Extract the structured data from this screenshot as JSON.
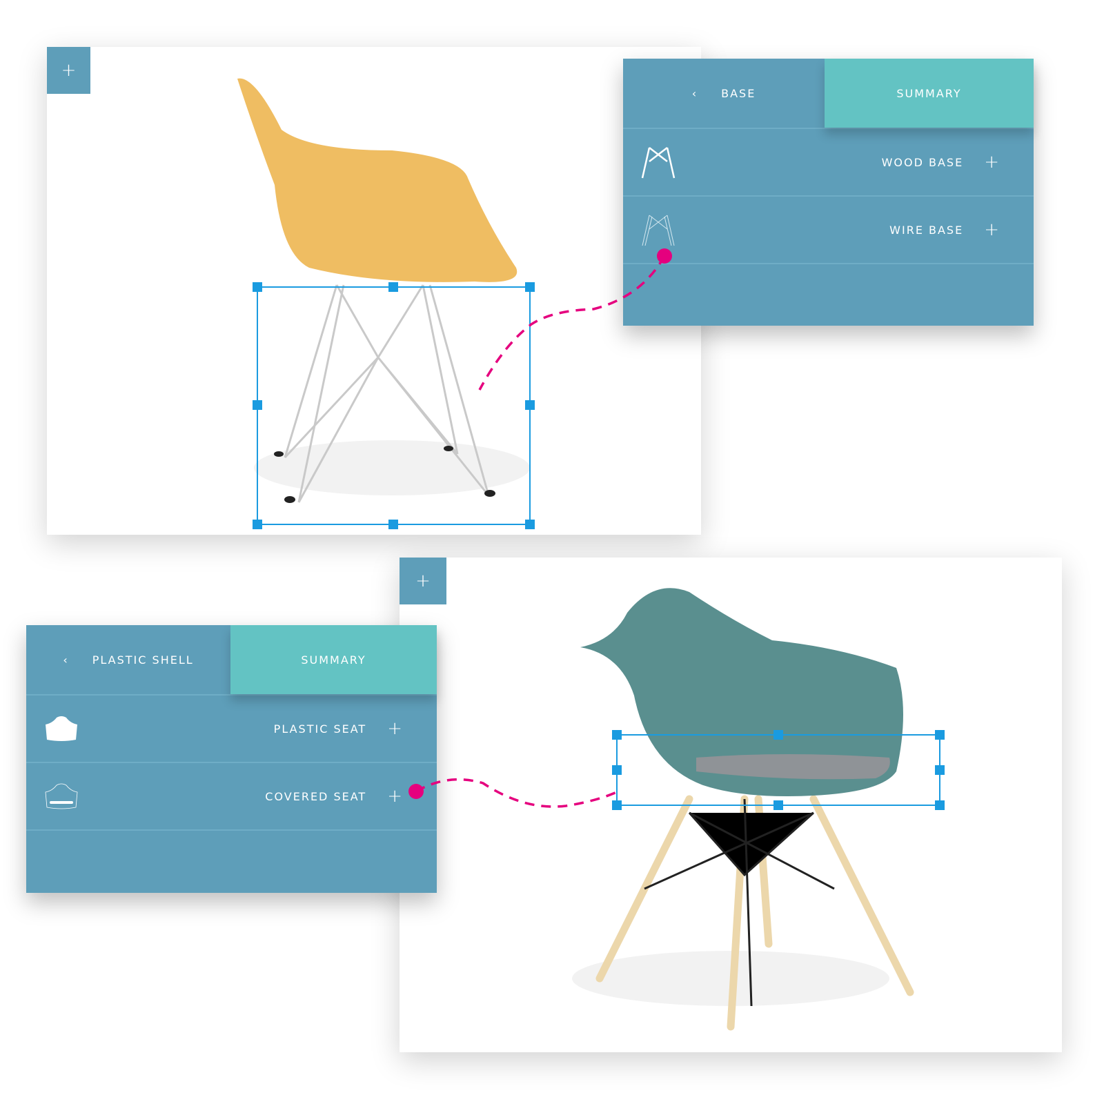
{
  "colors": {
    "panel": "#5e9eb9",
    "summary_tab": "#63c3c3",
    "selection": "#1a9be0",
    "connector": "#e5007e"
  },
  "top_card": {
    "add_icon": "+"
  },
  "base_panel": {
    "back_icon": "chevron-left-icon",
    "back_label": "BASE",
    "summary_label": "SUMMARY",
    "items": [
      {
        "label": "WOOD BASE",
        "icon": "wood-base-icon",
        "add": "+"
      },
      {
        "label": "WIRE BASE",
        "icon": "wire-base-icon",
        "add": "+"
      }
    ]
  },
  "bottom_card": {
    "add_icon": "+"
  },
  "shell_panel": {
    "back_icon": "chevron-left-icon",
    "back_label": "PLASTIC SHELL",
    "summary_label": "SUMMARY",
    "items": [
      {
        "label": "PLASTIC SEAT",
        "icon": "plastic-seat-icon",
        "add": "+"
      },
      {
        "label": "COVERED SEAT",
        "icon": "covered-seat-icon",
        "add": "+"
      }
    ]
  }
}
